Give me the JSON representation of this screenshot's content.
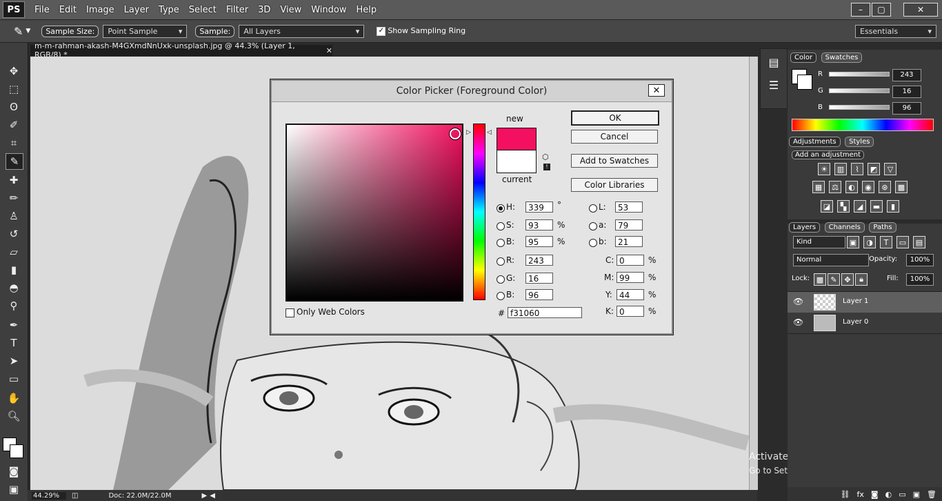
{
  "app": {
    "logo": "PS",
    "menu": [
      "File",
      "Edit",
      "Image",
      "Layer",
      "Type",
      "Select",
      "Filter",
      "3D",
      "View",
      "Window",
      "Help"
    ],
    "window_buttons": [
      "–",
      "▢",
      "✕"
    ]
  },
  "options_bar": {
    "sample_size_label": "Sample Size:",
    "sample_size_value": "Point Sample",
    "sample_label": "Sample:",
    "sample_value": "All Layers",
    "show_ring_label": "Show Sampling Ring",
    "show_ring_checked": true,
    "workspace": "Essentials"
  },
  "document": {
    "tab_title": "m-m-rahman-akash-M4GXmdNnUxk-unsplash.jpg @ 44.3% (Layer 1, RGB/8) *",
    "tab_close": "✕"
  },
  "status_bar": {
    "zoom": "44.29%",
    "doc_info": "Doc: 22.0M/22.0M"
  },
  "watermark": {
    "line1": "Activate Windows",
    "line2": "Go to Settings to activate Windows."
  },
  "color_panel": {
    "tabs": [
      "Color",
      "Swatches"
    ],
    "active_tab": "Color",
    "channels": [
      {
        "label": "R",
        "value": "243"
      },
      {
        "label": "G",
        "value": "16"
      },
      {
        "label": "B",
        "value": "96"
      }
    ]
  },
  "adjustments_panel": {
    "tabs": [
      "Adjustments",
      "Styles"
    ],
    "active_tab": "Adjustments",
    "title": "Add an adjustment"
  },
  "layers_panel": {
    "tabs": [
      "Layers",
      "Channels",
      "Paths"
    ],
    "active_tab": "Layers",
    "kind": "Kind",
    "blend_mode": "Normal",
    "opacity_label": "Opacity:",
    "opacity_value": "100%",
    "lock_label": "Lock:",
    "fill_label": "Fill:",
    "fill_value": "100%",
    "layers": [
      {
        "name": "Layer 1",
        "selected": true
      },
      {
        "name": "Layer 0",
        "selected": false
      }
    ]
  },
  "color_picker": {
    "title": "Color Picker (Foreground Color)",
    "close": "✕",
    "new_label": "new",
    "current_label": "current",
    "new_color": "#f31060",
    "current_color": "#ffffff",
    "buttons": {
      "ok": "OK",
      "cancel": "Cancel",
      "add_swatches": "Add to Swatches",
      "libraries": "Color Libraries"
    },
    "hsb": [
      {
        "label": "H:",
        "value": "339",
        "unit": "°",
        "selected": true
      },
      {
        "label": "S:",
        "value": "93",
        "unit": "%",
        "selected": false
      },
      {
        "label": "B:",
        "value": "95",
        "unit": "%",
        "selected": false
      }
    ],
    "rgb": [
      {
        "label": "R:",
        "value": "243"
      },
      {
        "label": "G:",
        "value": "16"
      },
      {
        "label": "B:",
        "value": "96"
      }
    ],
    "lab": [
      {
        "label": "L:",
        "value": "53"
      },
      {
        "label": "a:",
        "value": "79"
      },
      {
        "label": "b:",
        "value": "21"
      }
    ],
    "cmyk": [
      {
        "label": "C:",
        "value": "0",
        "unit": "%"
      },
      {
        "label": "M:",
        "value": "99",
        "unit": "%"
      },
      {
        "label": "Y:",
        "value": "44",
        "unit": "%"
      },
      {
        "label": "K:",
        "value": "0",
        "unit": "%"
      }
    ],
    "hex_label": "#",
    "hex_value": "f31060",
    "only_web_label": "Only Web Colors",
    "only_web_checked": false
  }
}
